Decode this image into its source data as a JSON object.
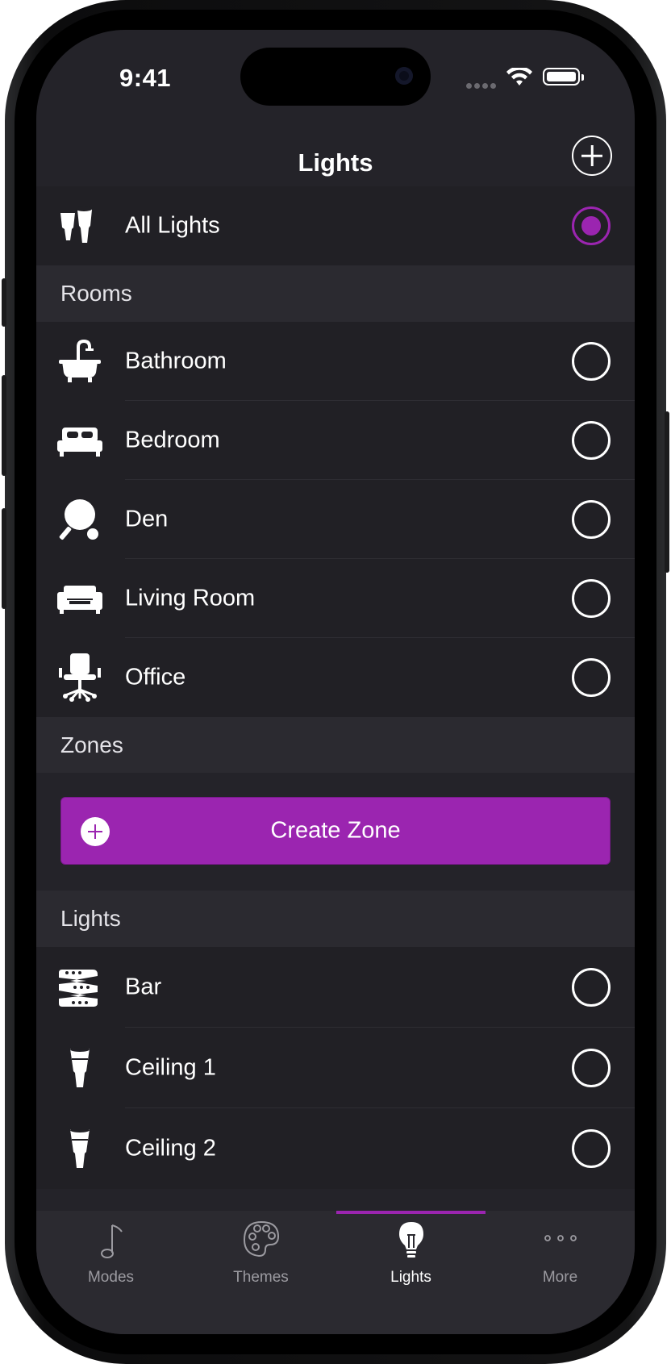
{
  "status_bar": {
    "time": "9:41"
  },
  "nav": {
    "title": "Lights"
  },
  "all_lights": {
    "label": "All Lights",
    "selected": true
  },
  "sections": {
    "rooms": "Rooms",
    "zones": "Zones",
    "lights": "Lights"
  },
  "rooms": [
    {
      "label": "Bathroom",
      "icon": "bathtub-icon"
    },
    {
      "label": "Bedroom",
      "icon": "bed-icon"
    },
    {
      "label": "Den",
      "icon": "ping-pong-icon"
    },
    {
      "label": "Living Room",
      "icon": "sofa-icon"
    },
    {
      "label": "Office",
      "icon": "office-chair-icon"
    }
  ],
  "create_zone": {
    "label": "Create Zone"
  },
  "lights": [
    {
      "label": "Bar",
      "icon": "lightstrip-icon"
    },
    {
      "label": "Ceiling 1",
      "icon": "bulb-icon"
    },
    {
      "label": "Ceiling 2",
      "icon": "bulb-icon"
    }
  ],
  "tabs": [
    {
      "label": "Modes",
      "icon": "music-note-icon",
      "active": false
    },
    {
      "label": "Themes",
      "icon": "palette-icon",
      "active": false
    },
    {
      "label": "Lights",
      "icon": "lightbulb-icon",
      "active": true
    },
    {
      "label": "More",
      "icon": "more-icon",
      "active": false
    }
  ],
  "colors": {
    "accent": "#9b25b0",
    "background": "#242329",
    "row": "#212025",
    "header": "#2b2a30"
  }
}
